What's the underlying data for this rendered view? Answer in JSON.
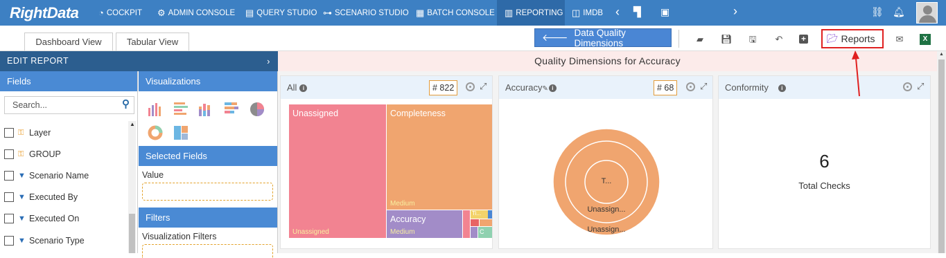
{
  "app": {
    "logo": "RightData"
  },
  "nav": [
    {
      "label": "COCKPIT",
      "icon": "dashboard-gauge-icon"
    },
    {
      "label": "ADMIN CONSOLE",
      "icon": "gear-icon"
    },
    {
      "label": "QUERY STUDIO",
      "icon": "database-icon"
    },
    {
      "label": "SCENARIO STUDIO",
      "icon": "flow-icon"
    },
    {
      "label": "BATCH CONSOLE",
      "icon": "batch-icon"
    },
    {
      "label": "REPORTING",
      "icon": "bar-chart-icon",
      "active": true
    },
    {
      "label": "IMDB",
      "icon": "columns-icon"
    }
  ],
  "tabs": {
    "dashboard": "Dashboard View",
    "tabular": "Tabular View"
  },
  "toolbar": {
    "back_button": "Data Quality Dimensions",
    "reports_button": "Reports"
  },
  "left": {
    "edit_report": "EDIT REPORT",
    "fields_header": "Fields",
    "search_placeholder": "Search...",
    "fields": [
      {
        "label": "Layer",
        "icon": "key-icon"
      },
      {
        "label": "GROUP",
        "icon": "key-icon"
      },
      {
        "label": "Scenario Name",
        "icon": "filter-icon"
      },
      {
        "label": "Executed By",
        "icon": "filter-icon"
      },
      {
        "label": "Executed On",
        "icon": "filter-icon"
      },
      {
        "label": "Scenario Type",
        "icon": "filter-icon"
      }
    ],
    "visualizations_header": "Visualizations",
    "selected_fields_header": "Selected Fields",
    "value_label": "Value",
    "filters_header": "Filters",
    "visualization_filters_label": "Visualization Filters"
  },
  "main": {
    "title": "Quality Dimensions for Accuracy",
    "cards": {
      "all": {
        "title": "All",
        "count": "# 822"
      },
      "accuracy": {
        "title": "Accuracy",
        "count": "# 68"
      },
      "conformity": {
        "title": "Conformity",
        "value": "6",
        "caption": "Total Checks"
      }
    },
    "treemap": {
      "unassigned": "Unassigned",
      "unassigned_sub": "Unassigned",
      "completeness": "Completeness",
      "completeness_sub": "Medium",
      "accuracy": "Accuracy",
      "accuracy_sub": "Medium",
      "small_a": "Ti...",
      "small_b": "C"
    },
    "sunburst": {
      "center": "T...",
      "ring1": "Unassign...",
      "ring2": "Unassign..."
    }
  },
  "colors": {
    "topbar": "#3d80c3",
    "edit_bar": "#2c5e8f",
    "section": "#4a8ad4",
    "unassigned": "#f28391",
    "completeness": "#f0a56f",
    "accuracy": "#a28cc8"
  }
}
